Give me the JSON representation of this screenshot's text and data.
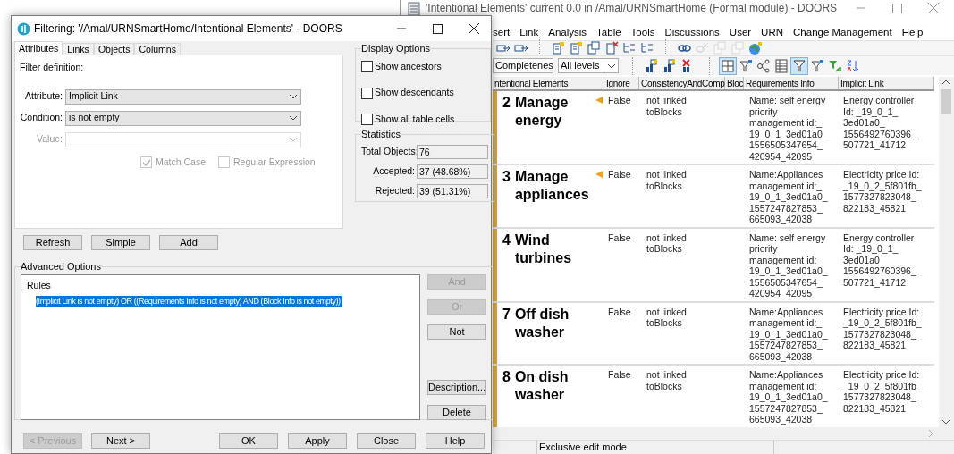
{
  "background_window": {
    "title": "'Intentional Elements' current 0.0 in /Amal/URNSmartHome (Formal module) - DOORS",
    "menu": [
      "sert",
      "Link",
      "Analysis",
      "Table",
      "Tools",
      "Discussions",
      "User",
      "URN",
      "Change Management",
      "Help"
    ],
    "toolbar_1": [
      [
        {
          "kind": "arrow-doc",
          "disabled": false
        },
        {
          "kind": "arrow-doc",
          "disabled": false
        }
      ],
      [
        {
          "kind": "doc-star",
          "disabled": false
        },
        {
          "kind": "doc-star",
          "disabled": false
        },
        {
          "kind": "doc",
          "disabled": false
        },
        {
          "kind": "doc-x",
          "disabled": false
        },
        {
          "kind": "tree",
          "disabled": false
        },
        {
          "kind": "tree",
          "disabled": false
        }
      ],
      [
        {
          "kind": "link",
          "disabled": false
        },
        {
          "kind": "link-x",
          "disabled": true
        },
        {
          "kind": "doc",
          "disabled": true
        },
        {
          "kind": "doc",
          "disabled": true
        },
        {
          "kind": "globe",
          "disabled": false
        }
      ]
    ],
    "view_dropdowns": [
      "Completenes",
      "All levels"
    ],
    "toolbar_2": [
      [
        {
          "kind": "hierarchy",
          "pressed": false
        },
        {
          "kind": "hierarchy",
          "pressed": false
        },
        {
          "kind": "hierarchy-x",
          "pressed": false
        }
      ],
      [
        {
          "kind": "split",
          "pressed": true
        },
        {
          "kind": "filter-star",
          "pressed": false
        },
        {
          "kind": "branch",
          "pressed": false
        },
        {
          "kind": "table",
          "pressed": false
        },
        {
          "kind": "filter",
          "pressed": true
        },
        {
          "kind": "filter-star",
          "pressed": false
        },
        {
          "kind": "filter-arrow",
          "pressed": false
        },
        {
          "kind": "sort",
          "pressed": false
        }
      ]
    ],
    "table": {
      "columns": [
        "ntentional Elements",
        "Ignore",
        "ConsistencyAndComp",
        "Bloc",
        "Requirements Info",
        "Implicit Link"
      ],
      "rows": [
        {
          "number": "2",
          "heading": "Manage energy",
          "marker": true,
          "ignore": "False",
          "consistency": [
            "not linked",
            "toBlocks"
          ],
          "requirements_info": [
            "Name: self energy",
            "priority",
            "management id:_",
            "19_0_1_3ed01a0_",
            "1556505347654_",
            "420954_42095"
          ],
          "implicit_link": [
            "Energy controller",
            "Id: _19_0_1_",
            "3ed01a0_",
            "1556492760396_",
            "507721_41712"
          ]
        },
        {
          "number": "3",
          "heading": "Manage appliances",
          "marker": true,
          "ignore": "False",
          "consistency": [
            "not linked",
            "toBlocks"
          ],
          "requirements_info": [
            "Name:Appliances",
            "management id:_",
            "19_0_1_3ed01a0_",
            "1557247827853_",
            "665093_42038"
          ],
          "implicit_link": [
            "Electricity price Id:",
            "_19_0_2_5f801fb_",
            "1577327823048_",
            "822183_45821"
          ]
        },
        {
          "number": "4",
          "heading": "Wind turbines",
          "marker": false,
          "ignore": "False",
          "consistency": [
            "not linked",
            "toBlocks"
          ],
          "requirements_info": [
            "Name: self energy",
            "priority",
            "management id:_",
            "19_0_1_3ed01a0_",
            "1556505347654_",
            "420954_42095"
          ],
          "implicit_link": [
            "Energy controller",
            "Id: _19_0_1_",
            "3ed01a0_",
            "1556492760396_",
            "507721_41712"
          ]
        },
        {
          "number": "7",
          "heading": "Off dish washer",
          "marker": false,
          "ignore": "False",
          "consistency": [
            "not linked",
            "toBlocks"
          ],
          "requirements_info": [
            "Name:Appliances",
            "management id:_",
            "19_0_1_3ed01a0_",
            "1557247827853_",
            "665093_42038"
          ],
          "implicit_link": [
            "Electricity price Id:",
            "_19_0_2_5f801fb_",
            "1577327823048_",
            "822183_45821"
          ]
        },
        {
          "number": "8",
          "heading": "On dish washer",
          "marker": false,
          "ignore": "False",
          "consistency": [
            "not linked",
            "toBlocks"
          ],
          "requirements_info": [
            "Name:Appliances",
            "management id:_",
            "19_0_1_3ed01a0_",
            "1557247827853_",
            "665093_42038"
          ],
          "implicit_link": [
            "Electricity price Id:",
            "_19_0_2_5f801fb_",
            "1577327823048_",
            "822183_45821"
          ]
        }
      ]
    },
    "status_bar": "Exclusive edit mode"
  },
  "dialog": {
    "title": "Filtering: '/Amal/URNSmartHome/Intentional Elements' - DOORS",
    "tabs": [
      {
        "label": "Attributes",
        "selected": true
      },
      {
        "label": "Links",
        "selected": false
      },
      {
        "label": "Objects",
        "selected": false
      },
      {
        "label": "Columns",
        "selected": false
      }
    ],
    "filter_definition_label": "Filter definition:",
    "fields": [
      {
        "label": "Attribute:",
        "value": "Implicit Link",
        "disabled": false
      },
      {
        "label": "Condition:",
        "value": "is not empty",
        "disabled": false
      },
      {
        "label": "Value:",
        "disabled": true
      }
    ],
    "options": [
      {
        "label": "Match Case",
        "checked": true,
        "disabled": true
      },
      {
        "label": "Regular Expression",
        "checked": false,
        "disabled": true
      }
    ],
    "panel_buttons": [
      "Refresh",
      "Simple",
      "Add"
    ],
    "display_options": {
      "title": "Display Options",
      "items": [
        {
          "label": "Show ancestors",
          "checked": false
        },
        {
          "label": "Show descendants",
          "checked": false
        },
        {
          "label": "Show all table cells",
          "checked": false
        }
      ]
    },
    "statistics": {
      "title": "Statistics",
      "items": [
        {
          "label": "Total Objects:",
          "value": "76"
        },
        {
          "label": "Accepted:",
          "value": "37 (48.68%)"
        },
        {
          "label": "Rejected:",
          "value": "39 (51.31%)"
        }
      ]
    },
    "advanced": {
      "title": "Advanced Options",
      "rules_header": "Rules",
      "rules": [
        {
          "text": "(Implicit Link is not empty) OR ((Requirements Info is not empty) AND (Block Info is not empty))",
          "selected": true
        }
      ],
      "buttons": [
        {
          "label": "And",
          "disabled": true
        },
        {
          "label": "Or",
          "disabled": true
        },
        {
          "label": "Not",
          "disabled": false
        },
        {
          "label": "Description...",
          "disabled": false
        },
        {
          "label": "Delete",
          "disabled": false
        }
      ]
    },
    "footer_buttons": [
      {
        "label": "< Previous",
        "disabled": true
      },
      {
        "label": "Next >",
        "disabled": false
      },
      {
        "label": "OK",
        "disabled": false
      },
      {
        "label": "Apply",
        "disabled": false
      },
      {
        "label": "Close",
        "disabled": false
      },
      {
        "label": "Help",
        "disabled": false
      }
    ]
  }
}
